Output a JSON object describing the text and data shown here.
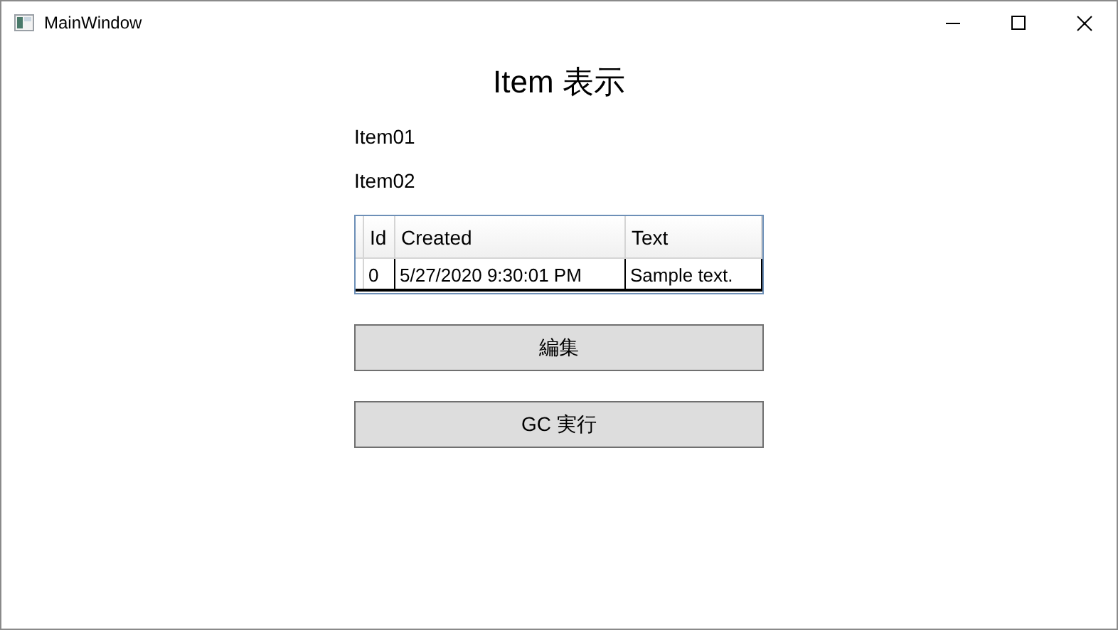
{
  "window": {
    "title": "MainWindow"
  },
  "heading": "Item 表示",
  "items": [
    "Item01",
    "Item02"
  ],
  "table": {
    "columns": [
      "Id",
      "Created",
      "Text"
    ],
    "rows": [
      [
        "0",
        "5/27/2020 9:30:01 PM",
        "Sample text."
      ]
    ]
  },
  "buttons": [
    "編集",
    "GC 実行"
  ]
}
